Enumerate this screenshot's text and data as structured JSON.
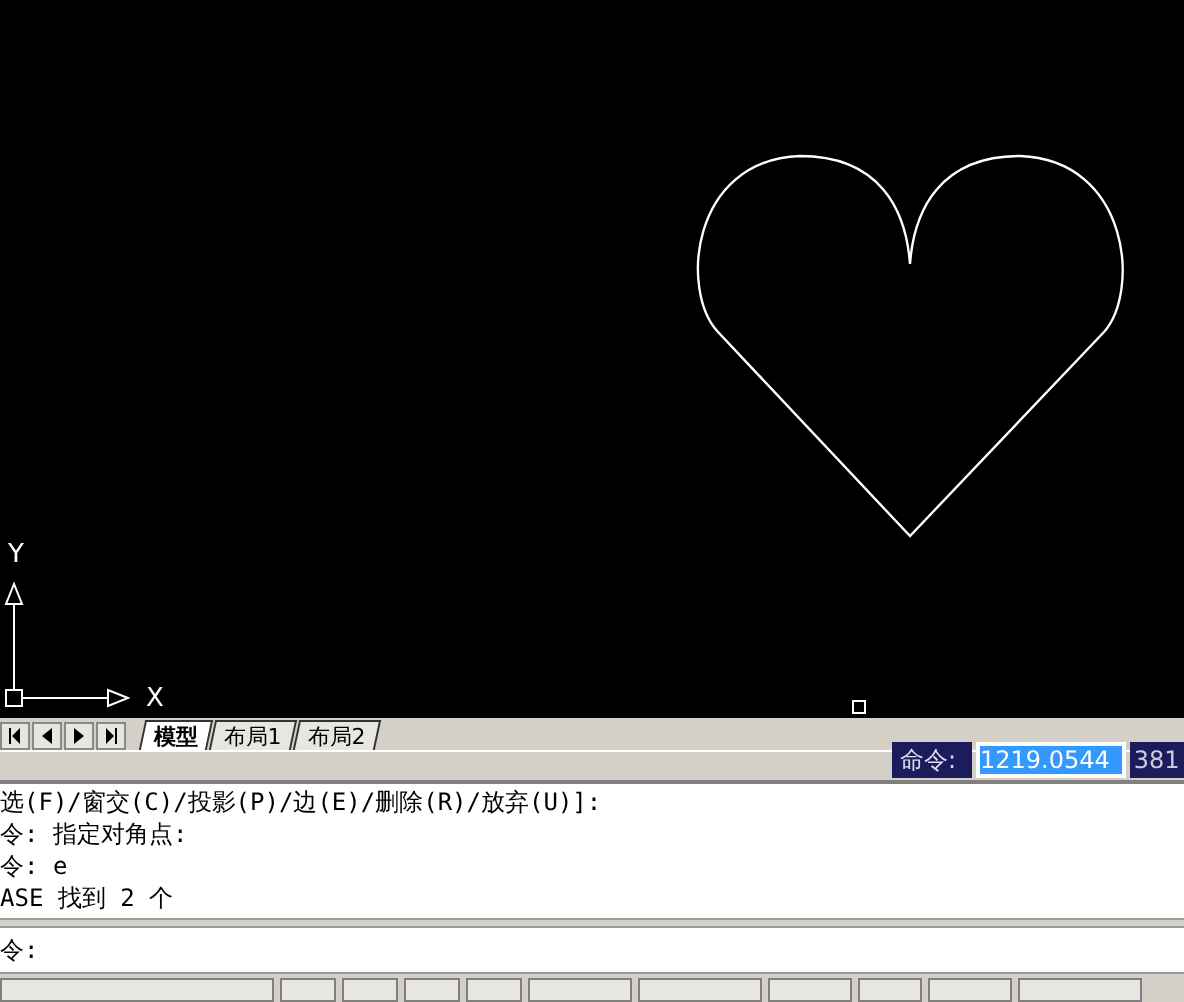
{
  "canvas": {
    "axis_labels": {
      "x": "X",
      "y": "Y"
    }
  },
  "layout_tabs": [
    {
      "label": "模型",
      "selected": true
    },
    {
      "label": "布局1",
      "selected": false
    },
    {
      "label": "布局2",
      "selected": false
    }
  ],
  "dynamic_input": {
    "label": "命令:",
    "values": [
      {
        "text": "1219.0544",
        "selected": true
      },
      {
        "text": "381",
        "selected": false
      }
    ]
  },
  "command_history": [
    "选(F)/窗交(C)/投影(P)/边(E)/删除(R)/放弃(U)]:",
    "令: 指定对角点:",
    "令: e",
    "ASE 找到 2 个"
  ],
  "command_line": {
    "prompt": "令:"
  }
}
